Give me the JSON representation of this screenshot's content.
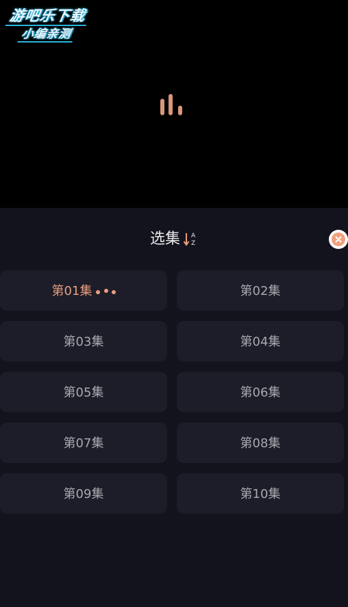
{
  "watermark": {
    "line1": "游吧乐下载",
    "line2": "小编亲测"
  },
  "player": {
    "state": "loading"
  },
  "episode_panel": {
    "title": "选集",
    "sort_icon": "sort-az-icon",
    "close_icon": "close-icon",
    "episodes": [
      {
        "label": "第01集",
        "active": true
      },
      {
        "label": "第02集",
        "active": false
      },
      {
        "label": "第03集",
        "active": false
      },
      {
        "label": "第04集",
        "active": false
      },
      {
        "label": "第05集",
        "active": false
      },
      {
        "label": "第06集",
        "active": false
      },
      {
        "label": "第07集",
        "active": false
      },
      {
        "label": "第08集",
        "active": false
      },
      {
        "label": "第09集",
        "active": false
      },
      {
        "label": "第10集",
        "active": false
      }
    ]
  },
  "colors": {
    "accent": "#e89d7e",
    "panel_bg": "#13131d",
    "tile_bg": "#1c1d29",
    "video_bg": "#000000"
  }
}
